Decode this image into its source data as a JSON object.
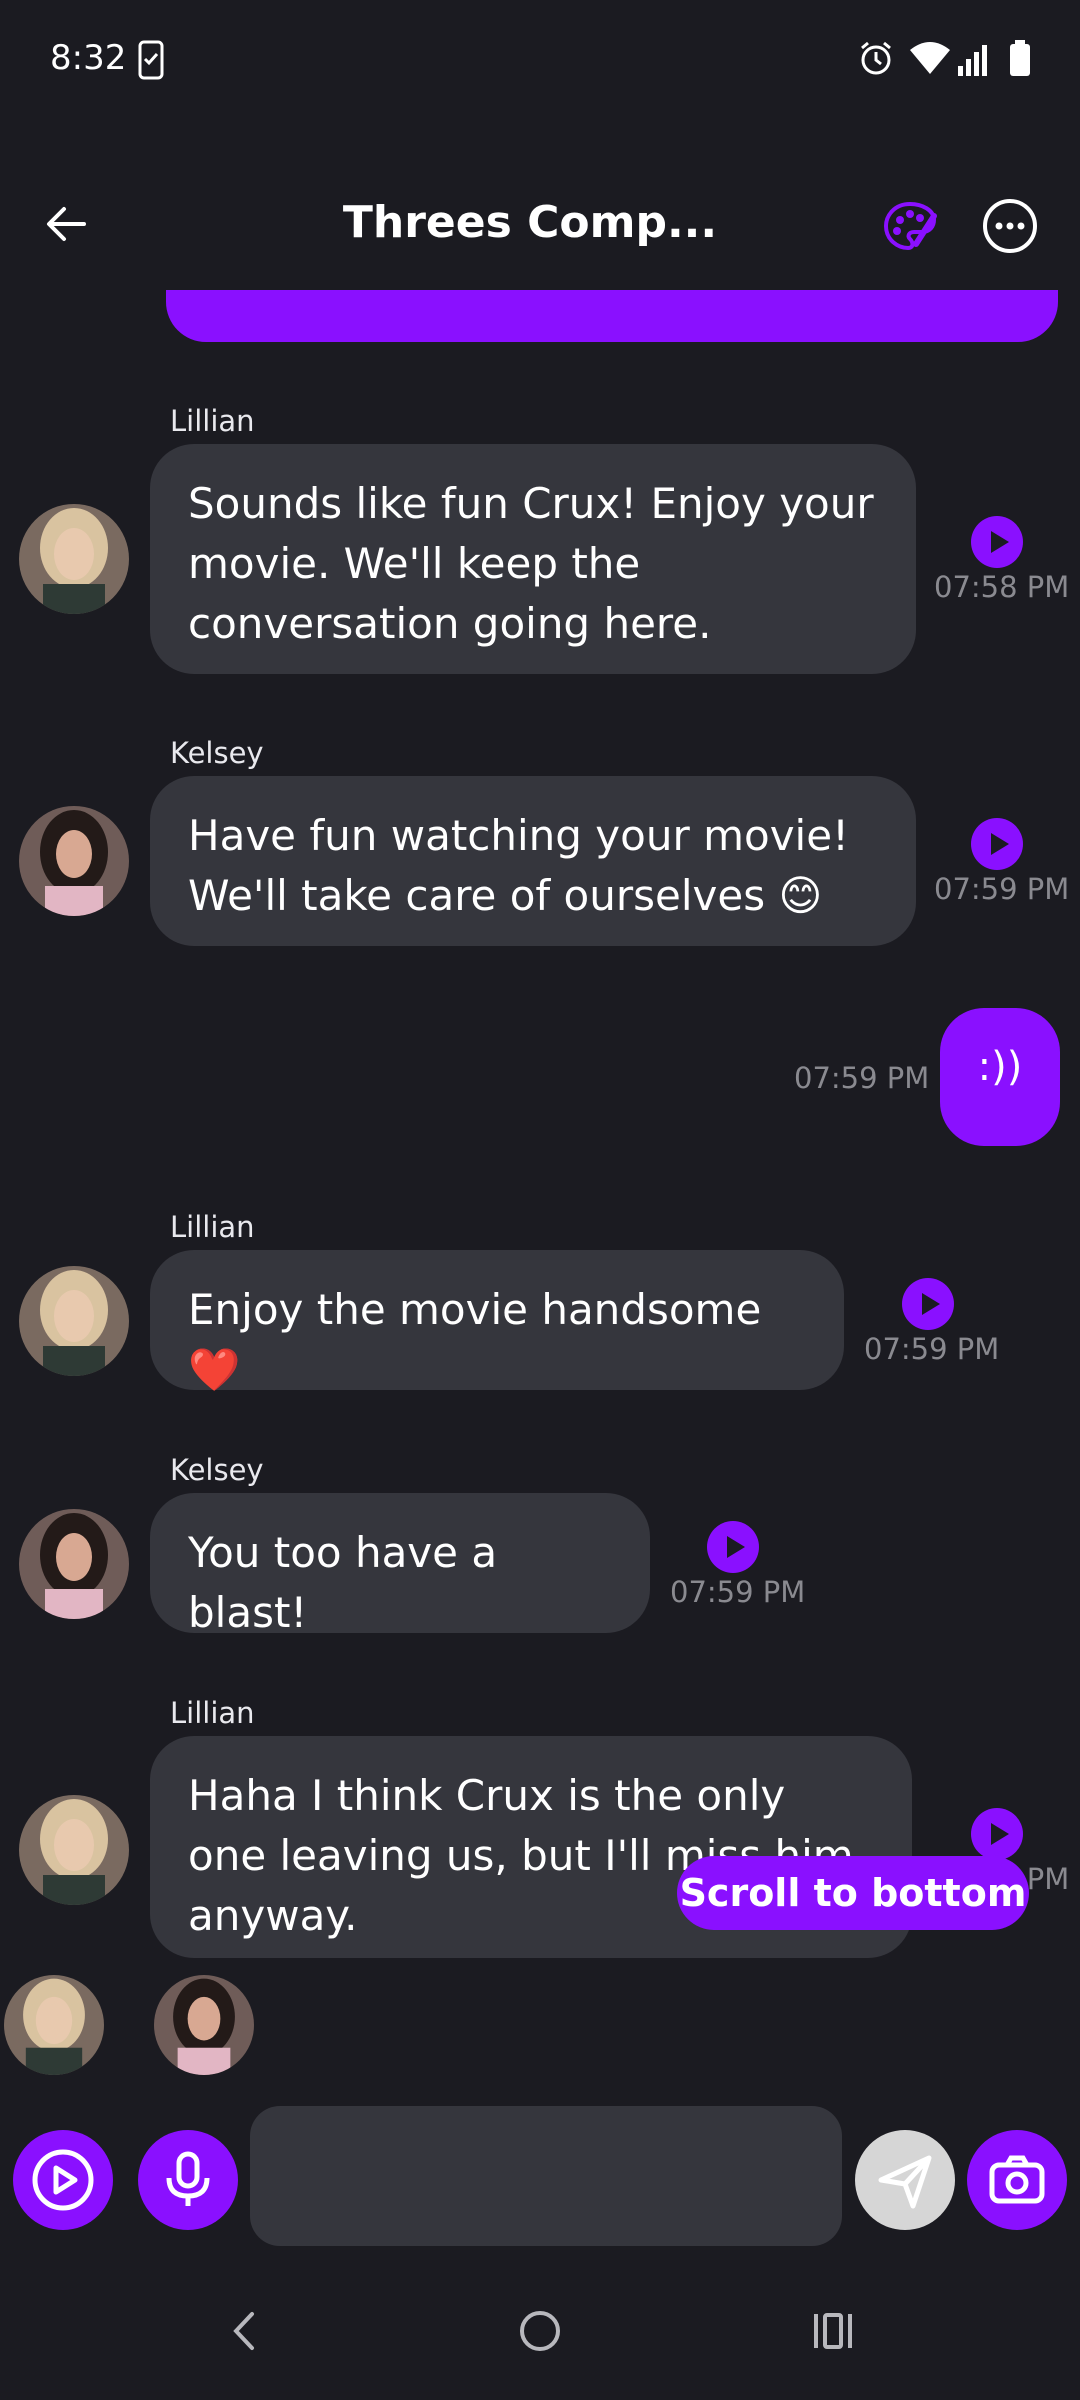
{
  "status_bar": {
    "time": "8:32"
  },
  "header": {
    "title": "Threes Comp..."
  },
  "colors": {
    "accent": "#8a10ff",
    "bubble": "#35363d",
    "background": "#1b1b21"
  },
  "messages": [
    {
      "sender": "Lillian",
      "text": "Sounds like fun Crux! Enjoy your movie. We'll keep the conversation going here.",
      "time": "07:58 PM"
    },
    {
      "sender": "Kelsey",
      "text": "Have fun watching your movie! We'll take care of ourselves 😊",
      "time": "07:59 PM"
    },
    {
      "sender": "me",
      "text": ":))",
      "time": "07:59 PM"
    },
    {
      "sender": "Lillian",
      "text": "Enjoy the movie handsome ❤️",
      "time": "07:59 PM"
    },
    {
      "sender": "Kelsey",
      "text": "You too have a blast!",
      "time": "07:59 PM"
    },
    {
      "sender": "Lillian",
      "text": "Haha I think Crux is the only one leaving us, but I'll miss him anyway.",
      "time": "07:59 PM"
    }
  ],
  "scroll_button": "Scroll to bottom",
  "composer": {
    "placeholder": ""
  }
}
